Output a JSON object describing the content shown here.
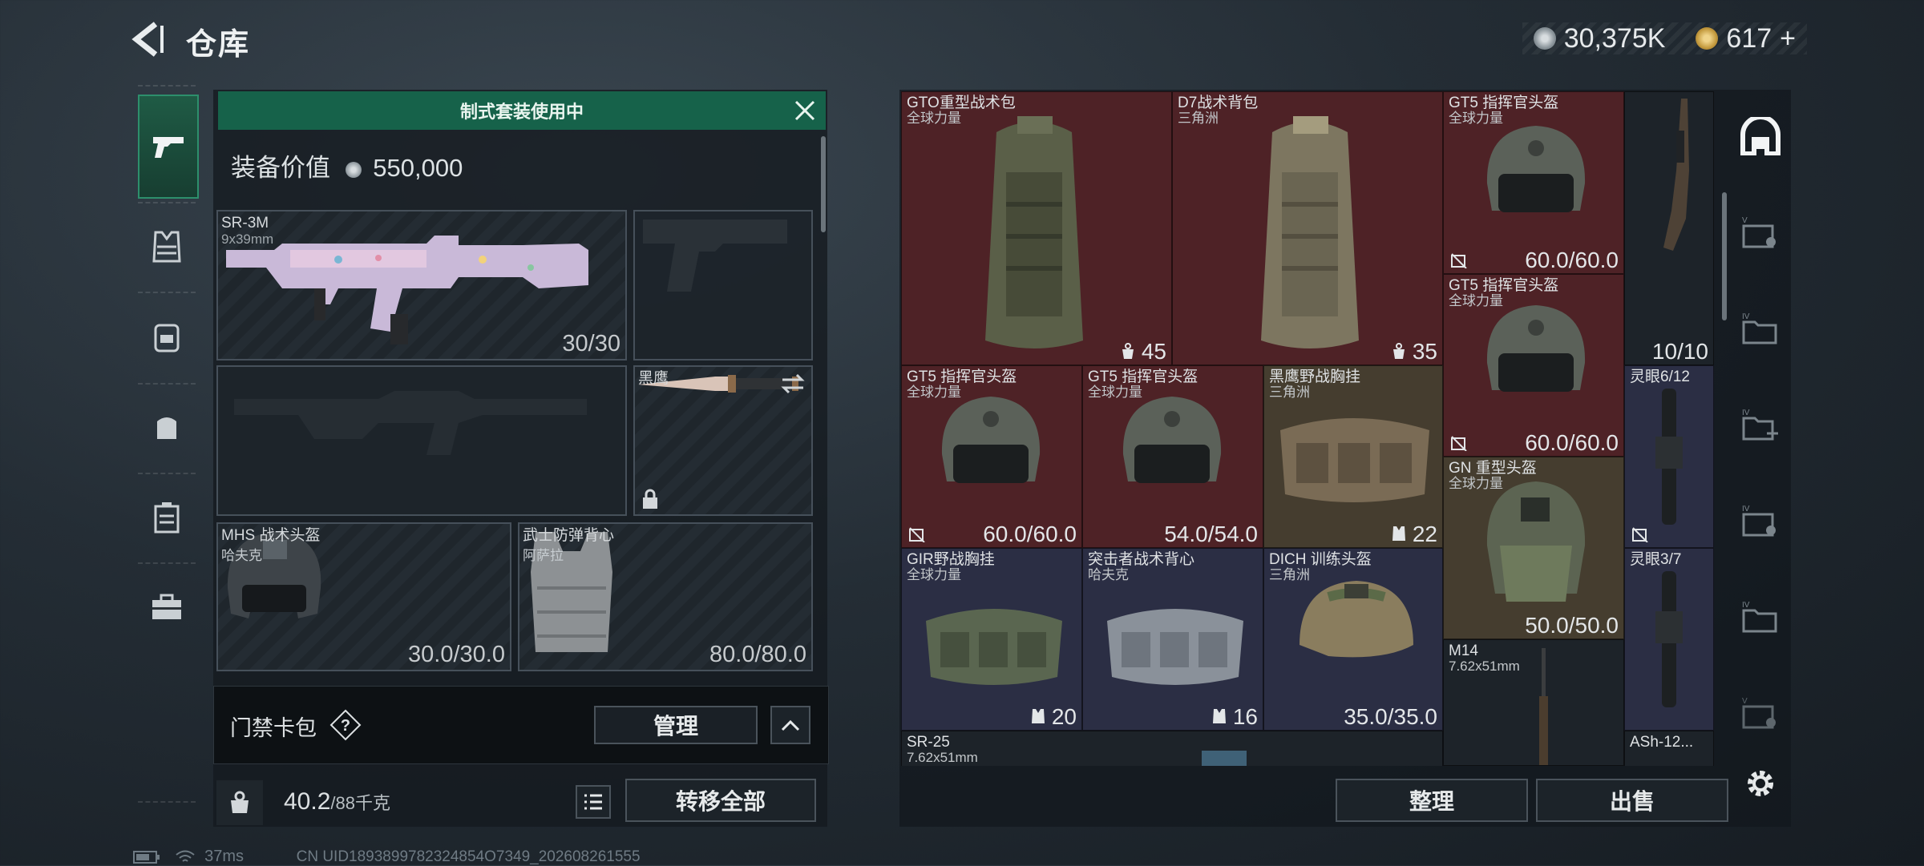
{
  "header": {
    "title": "仓库",
    "currency1": "30,375K",
    "currency2": "617",
    "currency2_plus": "+"
  },
  "leftnav": [
    "gun-icon",
    "vest-icon",
    "backpack-icon",
    "chest-rig-icon",
    "case-icon",
    "toolbox-icon"
  ],
  "loadout": {
    "banner": "制式套装使用中",
    "equip_value_label": "装备价值",
    "equip_value": "550,000",
    "primary": {
      "name": "SR-3M",
      "ammo_type": "9x39mm",
      "count": "30/30"
    },
    "melee": {
      "name": "黑鹰"
    },
    "helmet": {
      "name": "MHS 战术头盔",
      "sub": "哈夫克",
      "durability": "30.0/30.0"
    },
    "armor": {
      "name": "武士防弹背心",
      "sub": "阿萨拉",
      "durability": "80.0/80.0"
    },
    "keycard_label": "门禁卡包",
    "manage_button": "管理",
    "weight": "40.2",
    "weight_max": "/88千克",
    "transfer_all_button": "转移全部"
  },
  "inventory": {
    "items": [
      {
        "name": "GTO重型战术包",
        "sub": "全球力量",
        "value": "45",
        "color": "red"
      },
      {
        "name": "D7战术背包",
        "sub": "三角洲",
        "value": "35",
        "color": "red"
      },
      {
        "name": "GT5 指挥官头盔",
        "sub": "全球力量",
        "value": "60.0/60.0",
        "color": "red"
      },
      {
        "name": "",
        "sub": "",
        "value": "10/10",
        "color": "dk"
      },
      {
        "name": "GT5 指挥官头盔",
        "sub": "全球力量",
        "value": "60.0/60.0",
        "color": "red"
      },
      {
        "name": "GT5 指挥官头盔",
        "sub": "全球力量",
        "value": "60.0/60.0",
        "color": "red"
      },
      {
        "name": "GT5 指挥官头盔",
        "sub": "全球力量",
        "value": "54.0/54.0",
        "color": "red"
      },
      {
        "name": "黑鹰野战胸挂",
        "sub": "三角洲",
        "value": "22",
        "color": "tan"
      },
      {
        "name": "灵眼6/12",
        "sub": "",
        "value": "",
        "color": "blu"
      },
      {
        "name": "GN 重型头盔",
        "sub": "全球力量",
        "value": "50.0/50.0",
        "color": "tan"
      },
      {
        "name": "GIR野战胸挂",
        "sub": "全球力量",
        "value": "20",
        "color": "blu"
      },
      {
        "name": "突击者战术背心",
        "sub": "哈夫克",
        "value": "16",
        "color": "blu"
      },
      {
        "name": "DICH 训练头盔",
        "sub": "三角洲",
        "value": "35.0/35.0",
        "color": "blu"
      },
      {
        "name": "灵眼3/7",
        "sub": "",
        "value": "",
        "color": "blu"
      },
      {
        "name": "M14",
        "sub": "7.62x51mm",
        "value": "",
        "color": "dk"
      },
      {
        "name": "SR-25",
        "sub": "7.62x51mm",
        "value": "",
        "color": "dk"
      },
      {
        "name": "ASh-12...",
        "sub": "",
        "value": "",
        "color": "dk"
      }
    ],
    "sort_button": "整理",
    "sell_button": "出售"
  },
  "status": {
    "ping": "37ms",
    "uid": "CN UID1893899782324854O7349_202608261555"
  },
  "colors": {
    "accent_green": "#16624a",
    "rarity_red": "#4e2226",
    "rarity_gold": "#453d2f",
    "rarity_purple": "#2b2e44"
  }
}
